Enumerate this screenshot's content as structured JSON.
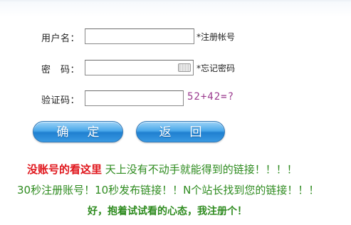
{
  "form": {
    "username": {
      "label": "用户名：",
      "value": "",
      "hint": "*注册帐号"
    },
    "password": {
      "label": "密　码：",
      "value": "",
      "hint": "*忘记密码"
    },
    "captcha": {
      "label": "验证码：",
      "value": "",
      "question": "52+42=?"
    }
  },
  "buttons": {
    "confirm": "确定",
    "back": "返回"
  },
  "promo": {
    "line1_red": "没账号的看这里",
    "line1_green": "天上没有不动手就能得到的链接！！！！",
    "line2": "30秒注册账号！10秒发布链接！！N个站长找到您的链接！！！",
    "line3": "好，抱着试试看的心态，我注册个！"
  },
  "colors": {
    "accent_red": "#e0161c",
    "accent_green": "#2e8b1f",
    "button_blue": "#3a9ae2",
    "captcha_color": "#9b3a8e"
  },
  "icons": {
    "password_keyboard": "keyboard-icon"
  }
}
